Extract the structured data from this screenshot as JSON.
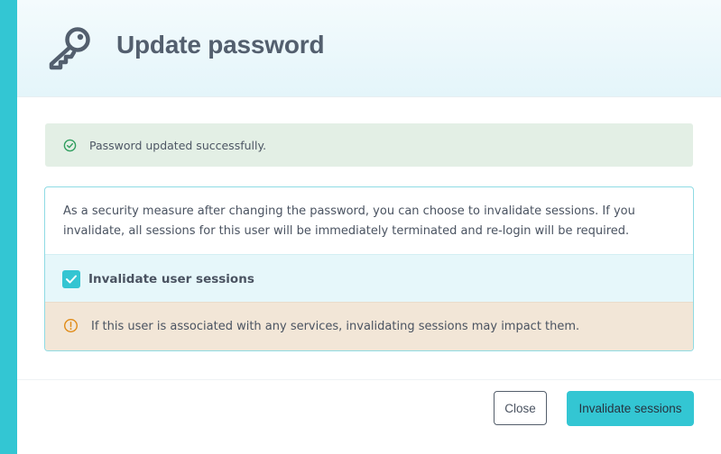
{
  "dialog": {
    "title": "Update password",
    "icon": "key-icon"
  },
  "success_alert": {
    "icon": "check-circle-icon",
    "message": "Password updated successfully."
  },
  "sessions_panel": {
    "info_text": "As a security measure after changing the password, you can choose to invalidate sessions. If you invalidate, all sessions for this user will be immediately terminated and re-login will be required.",
    "checkbox": {
      "label": "Invalidate user sessions",
      "checked": true
    },
    "warning": {
      "icon": "warning-circle-icon",
      "message": "If this user is associated with any services, invalidating sessions may impact them."
    }
  },
  "footer": {
    "close_label": "Close",
    "primary_label": "Invalidate sessions"
  },
  "colors": {
    "accent": "#33c6d3",
    "success_bg": "#e3efe5",
    "warning_bg": "#f2e6d7",
    "warning_icon": "#e08c1a",
    "title": "#535f6e"
  }
}
